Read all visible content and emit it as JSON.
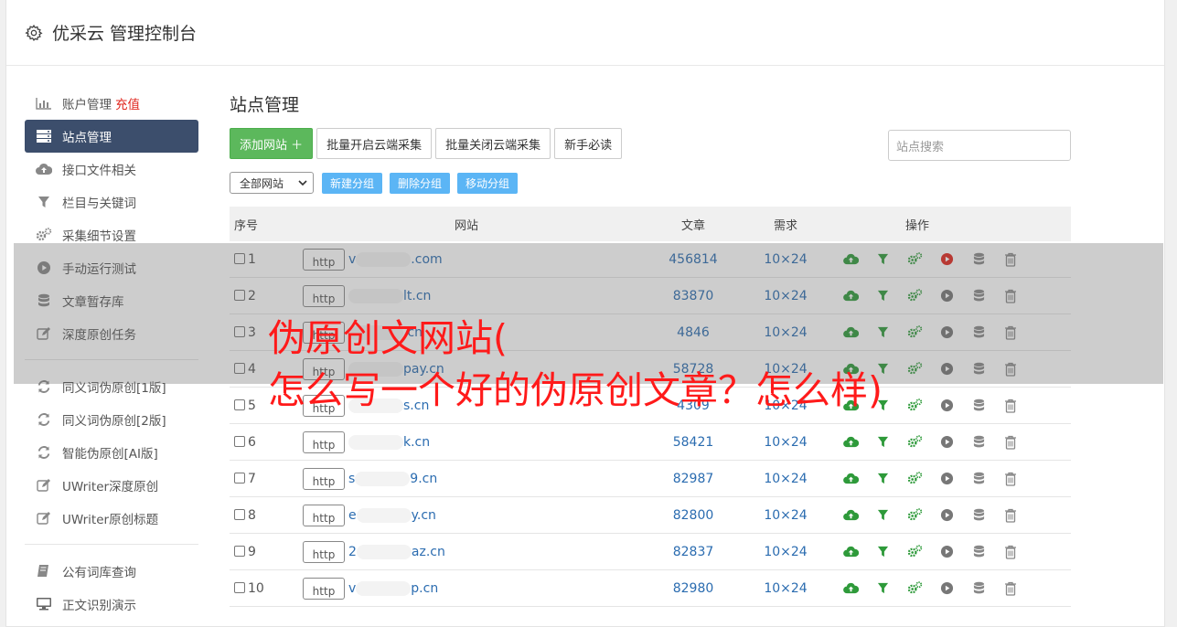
{
  "app": {
    "title": "优采云 管理控制台"
  },
  "sidebar": {
    "items": [
      {
        "label": "账户管理",
        "extra": "充值",
        "icon": "bar-chart-icon"
      },
      {
        "label": "站点管理",
        "icon": "server-icon",
        "active": true
      },
      {
        "label": "接口文件相关",
        "icon": "cloud-upload-icon"
      },
      {
        "label": "栏目与关键词",
        "icon": "filter-icon"
      },
      {
        "label": "采集细节设置",
        "icon": "cogs-icon"
      },
      {
        "label": "手动运行测试",
        "icon": "play-circle-icon"
      },
      {
        "label": "文章暂存库",
        "icon": "database-icon"
      },
      {
        "label": "深度原创任务",
        "icon": "edit-icon"
      },
      {
        "label": "同义词伪原创[1版]",
        "icon": "refresh-icon"
      },
      {
        "label": "同义词伪原创[2版]",
        "icon": "refresh-icon"
      },
      {
        "label": "智能伪原创[AI版]",
        "icon": "refresh-icon"
      },
      {
        "label": "UWriter深度原创",
        "icon": "edit-icon"
      },
      {
        "label": "UWriter原创标题",
        "icon": "edit-icon"
      },
      {
        "label": "公有词库查询",
        "icon": "book-icon"
      },
      {
        "label": "正文识别演示",
        "icon": "monitor-icon"
      }
    ]
  },
  "main": {
    "title": "站点管理",
    "toolbar": {
      "add_site": "添加网站 ＋",
      "batch_enable": "批量开启云端采集",
      "batch_disable": "批量关闭云端采集",
      "guide": "新手必读",
      "search_placeholder": "站点搜索"
    },
    "group": {
      "select_value": "全部网站",
      "new_group": "新建分组",
      "delete_group": "删除分组",
      "move_group": "移动分组"
    },
    "table": {
      "headers": {
        "idx": "序号",
        "site": "网站",
        "articles": "文章",
        "demand": "需求",
        "ops": "操作"
      },
      "http_label": "http",
      "rows": [
        {
          "idx": "1",
          "site_prefix": "v",
          "site_suffix": ".com",
          "articles": "456814",
          "demand": "10×24",
          "running": true
        },
        {
          "idx": "2",
          "site_prefix": "",
          "site_suffix": "lt.cn",
          "articles": "83870",
          "demand": "10×24",
          "running": false
        },
        {
          "idx": "3",
          "site_prefix": "",
          "site_suffix": ".cn",
          "articles": "4846",
          "demand": "10×24",
          "running": false
        },
        {
          "idx": "4",
          "site_prefix": "",
          "site_suffix": "pay.cn",
          "articles": "58728",
          "demand": "10×24",
          "running": false
        },
        {
          "idx": "5",
          "site_prefix": "",
          "site_suffix": "s.cn",
          "articles": "4309",
          "demand": "10×24",
          "running": false
        },
        {
          "idx": "6",
          "site_prefix": "",
          "site_suffix": "k.cn",
          "articles": "58421",
          "demand": "10×24",
          "running": false
        },
        {
          "idx": "7",
          "site_prefix": "s",
          "site_suffix": "9.cn",
          "articles": "82987",
          "demand": "10×24",
          "running": false
        },
        {
          "idx": "8",
          "site_prefix": "e",
          "site_suffix": "y.cn",
          "articles": "82800",
          "demand": "10×24",
          "running": false
        },
        {
          "idx": "9",
          "site_prefix": "2",
          "site_suffix": "az.cn",
          "articles": "82837",
          "demand": "10×24",
          "running": false
        },
        {
          "idx": "10",
          "site_prefix": "v",
          "site_suffix": "p.cn",
          "articles": "82980",
          "demand": "10×24",
          "running": false
        }
      ]
    }
  },
  "overlay": {
    "line1": "伪原创文网站(",
    "line2": "怎么写一个好的伪原创文章？怎么样)"
  },
  "colors": {
    "accent_green": "#5cb85c",
    "active_nav": "#3c4e6c",
    "link_blue": "#2b6cb0",
    "overlay_red": "#ff1a1a",
    "small_btn": "#5bb5f5"
  }
}
